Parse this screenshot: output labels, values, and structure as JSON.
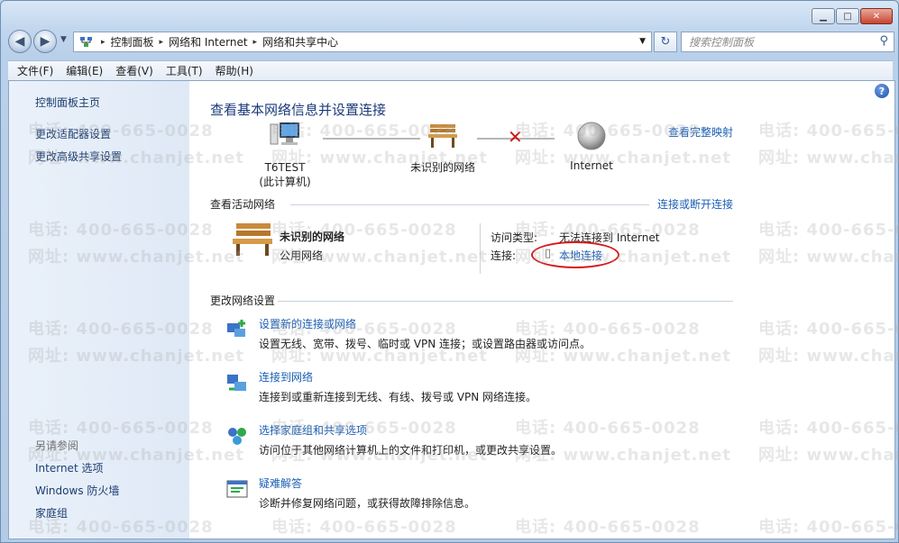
{
  "window": {
    "minimize": "▁",
    "maximize": "□",
    "close": "✕"
  },
  "nav": {
    "back": "◀",
    "forward": "▶",
    "dropdown": "▼"
  },
  "address": {
    "crumbs": [
      "控制面板",
      "网络和 Internet",
      "网络和共享中心"
    ],
    "separator": "▸",
    "dropdown": "▼"
  },
  "search": {
    "placeholder": "搜索控制面板",
    "icon": "⚲"
  },
  "refresh_icon": "↻",
  "menu": [
    "文件(F)",
    "编辑(E)",
    "查看(V)",
    "工具(T)",
    "帮助(H)"
  ],
  "sidebar": {
    "links": [
      "控制面板主页",
      "更改适配器设置",
      "更改高级共享设置"
    ],
    "see_also_header": "另请参阅",
    "see_also": [
      "Internet 选项",
      "Windows 防火墙",
      "家庭组"
    ]
  },
  "help_icon": "?",
  "main": {
    "title": "查看基本网络信息并设置连接",
    "full_map_link": "查看完整映射",
    "nodes": {
      "computer_name": "T6TEST",
      "computer_sub": "(此计算机)",
      "network": "未识别的网络",
      "internet": "Internet"
    },
    "active_header": "查看活动网络",
    "connect_link": "连接或断开连接",
    "active": {
      "name": "未识别的网络",
      "type": "公用网络",
      "access_label": "访问类型:",
      "access_value": "无法连接到 Internet",
      "conn_label": "连接:",
      "conn_value": "本地连接"
    },
    "change_header": "更改网络设置",
    "tasks": [
      {
        "title": "设置新的连接或网络",
        "desc": "设置无线、宽带、拨号、临时或 VPN 连接；或设置路由器或访问点。"
      },
      {
        "title": "连接到网络",
        "desc": "连接到或重新连接到无线、有线、拨号或 VPN 网络连接。"
      },
      {
        "title": "选择家庭组和共享选项",
        "desc": "访问位于其他网络计算机上的文件和打印机，或更改共享设置。"
      },
      {
        "title": "疑难解答",
        "desc": "诊断并修复网络问题，或获得故障排除信息。"
      }
    ]
  },
  "watermark": {
    "phone": "电话: 400-665-0028",
    "site": "网址: www.chanjet.net"
  }
}
